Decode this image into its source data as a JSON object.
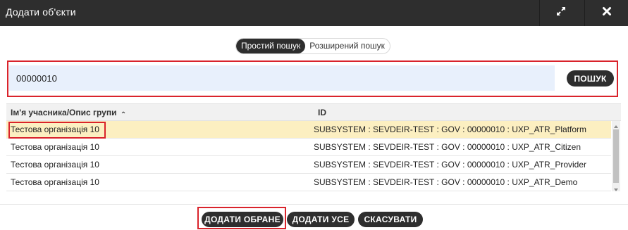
{
  "dialog": {
    "title": "Додати об'єкти",
    "icons": [
      "expand-icon",
      "close-icon"
    ]
  },
  "search_mode": {
    "simple_label": "Простий пошук",
    "advanced_label": "Розширений пошук",
    "active": "simple"
  },
  "search": {
    "value": "00000010",
    "button_label": "ПОШУК"
  },
  "table": {
    "columns": [
      "Ім'я учасника/Опис групи",
      "ID"
    ],
    "sort_indicator": "⌃",
    "rows": [
      {
        "name": "Тестова організація 10",
        "id": "SUBSYSTEM : SEVDEIR-TEST : GOV : 00000010 : UXP_ATR_Platform",
        "selected": true
      },
      {
        "name": "Тестова організація 10",
        "id": "SUBSYSTEM : SEVDEIR-TEST : GOV : 00000010 : UXP_ATR_Citizen",
        "selected": false
      },
      {
        "name": "Тестова організація 10",
        "id": "SUBSYSTEM : SEVDEIR-TEST : GOV : 00000010 : UXP_ATR_Provider",
        "selected": false
      },
      {
        "name": "Тестова організація 10",
        "id": "SUBSYSTEM : SEVDEIR-TEST : GOV : 00000010 : UXP_ATR_Demo",
        "selected": false
      }
    ]
  },
  "footer": {
    "add_selected_label": "ДОДАТИ ОБРАНЕ",
    "add_all_label": "ДОДАТИ УСЕ",
    "cancel_label": "СКАСУВАТИ"
  },
  "colors": {
    "header_bg": "#2e2e2e",
    "selected_row": "#fcefc1",
    "input_bg": "#e8f0fc",
    "highlight_red": "#d9232b"
  }
}
